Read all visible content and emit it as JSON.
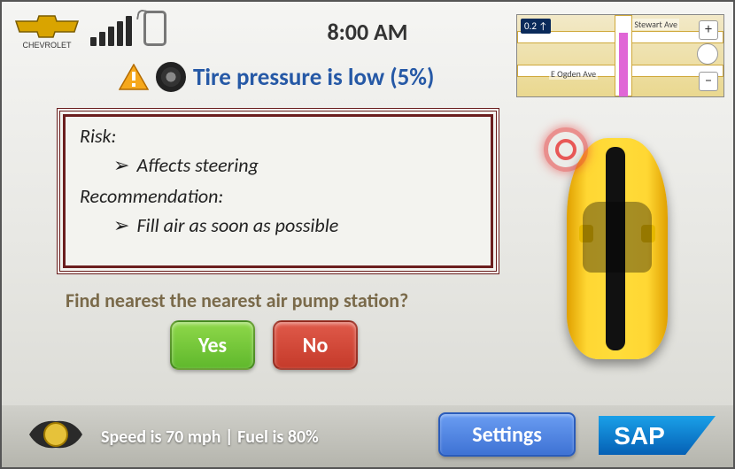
{
  "header": {
    "brand": "CHEVROLET",
    "time": "8:00 AM",
    "signal_bars": 5
  },
  "minimap": {
    "turn_hint": "0.2 ↑",
    "street_top": "Stewart Ave",
    "street_mid": "E Ogden Ave"
  },
  "alert": {
    "title": "Tire pressure is low (5%)",
    "risk_label": "Risk:",
    "risk_item": "Affects steering",
    "rec_label": "Recommendation:",
    "rec_item": "Fill air as soon as possible"
  },
  "prompt": {
    "question": "Find nearest the nearest air pump station?",
    "yes": "Yes",
    "no": "No"
  },
  "footer": {
    "status": "Speed is 70 mph  |  Fuel is 80%",
    "settings_label": "Settings",
    "partner_logo": "SAP"
  },
  "vehicle": {
    "affected_tire": "front-left"
  }
}
